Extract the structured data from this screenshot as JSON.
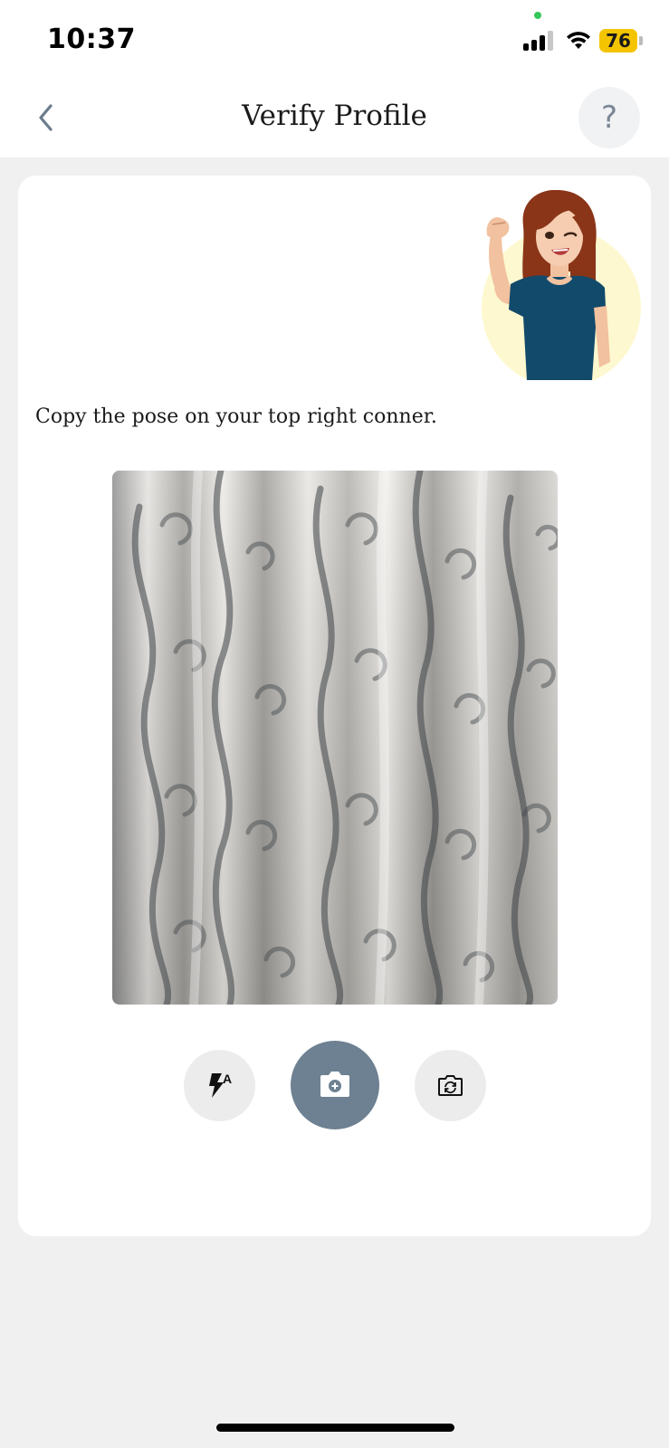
{
  "status_bar": {
    "time": "10:37",
    "battery": "76",
    "battery_color": "#f5c400",
    "camera_indicator_color": "#34c759",
    "icons": [
      "signal-icon",
      "wifi-icon",
      "battery-icon"
    ]
  },
  "header": {
    "title": "Verify Profile",
    "help_label": "?",
    "back_icon": "chevron-left-icon"
  },
  "content": {
    "instruction": "Copy the pose on your top right conner.",
    "pose_image": "woman-flexing-arm-winking-illustration",
    "camera_preview": "patterned-curtain-camera-feed"
  },
  "controls": {
    "flash_mode_label": "A",
    "flash_icon": "flash-auto-icon",
    "capture_icon": "camera-icon",
    "capture_color": "#6e8192",
    "switch_icon": "switch-camera-icon"
  }
}
